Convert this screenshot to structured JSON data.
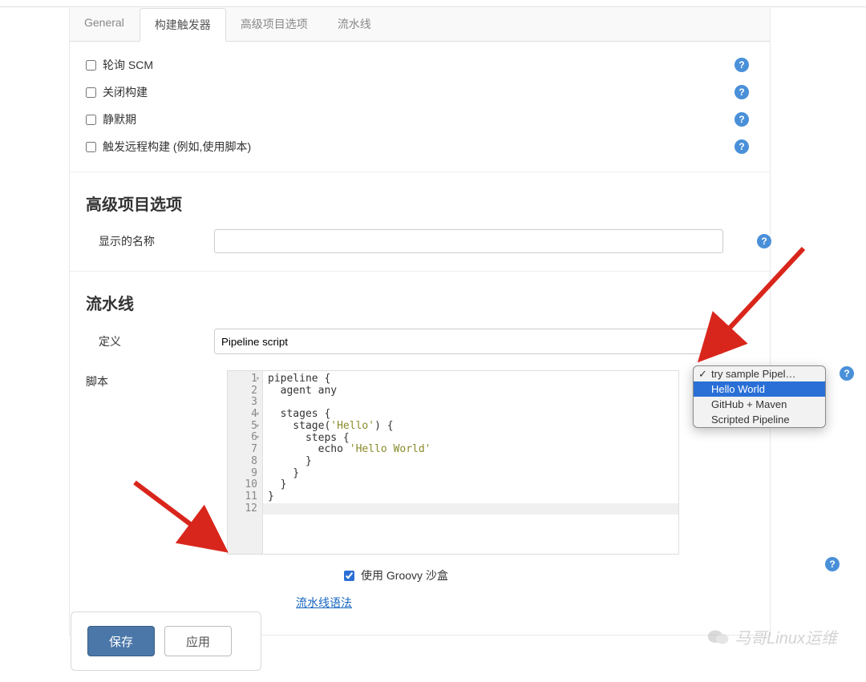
{
  "tabs": [
    {
      "label": "General",
      "active": false
    },
    {
      "label": "构建触发器",
      "active": true
    },
    {
      "label": "高级项目选项",
      "active": false
    },
    {
      "label": "流水线",
      "active": false
    }
  ],
  "triggers": [
    {
      "label": "轮询 SCM"
    },
    {
      "label": "关闭构建"
    },
    {
      "label": "静默期"
    },
    {
      "label": "触发远程构建 (例如,使用脚本)"
    }
  ],
  "advanced": {
    "title": "高级项目选项",
    "displayNameLabel": "显示的名称",
    "displayNameValue": ""
  },
  "pipeline": {
    "title": "流水线",
    "definitionLabel": "定义",
    "definitionValue": "Pipeline script",
    "scriptLabel": "脚本",
    "lines": [
      "1",
      "2",
      "3",
      "4",
      "5",
      "6",
      "7",
      "8",
      "9",
      "10",
      "11",
      "12"
    ],
    "foldLines": [
      1,
      4,
      5,
      6
    ],
    "code": "pipeline {\n  agent any\n\n  stages {\n    stage('Hello') {\n      steps {\n        echo 'Hello World'\n      }\n    }\n  }\n}\n ",
    "groovyLabel": "使用 Groovy 沙盒",
    "groovyChecked": true,
    "syntaxLinkLabel": "流水线语法",
    "sampleDropdown": [
      {
        "label": "try sample Pipel…",
        "checked": true,
        "hovered": false
      },
      {
        "label": "Hello World",
        "checked": false,
        "hovered": true
      },
      {
        "label": "GitHub + Maven",
        "checked": false,
        "hovered": false
      },
      {
        "label": "Scripted Pipeline",
        "checked": false,
        "hovered": false
      }
    ]
  },
  "buttons": {
    "save": "保存",
    "apply": "应用"
  },
  "watermark": "马哥Linux运维",
  "colors": {
    "arrow": "#d9261c",
    "primary": "#4a77a8",
    "help": "#4a90d9"
  }
}
